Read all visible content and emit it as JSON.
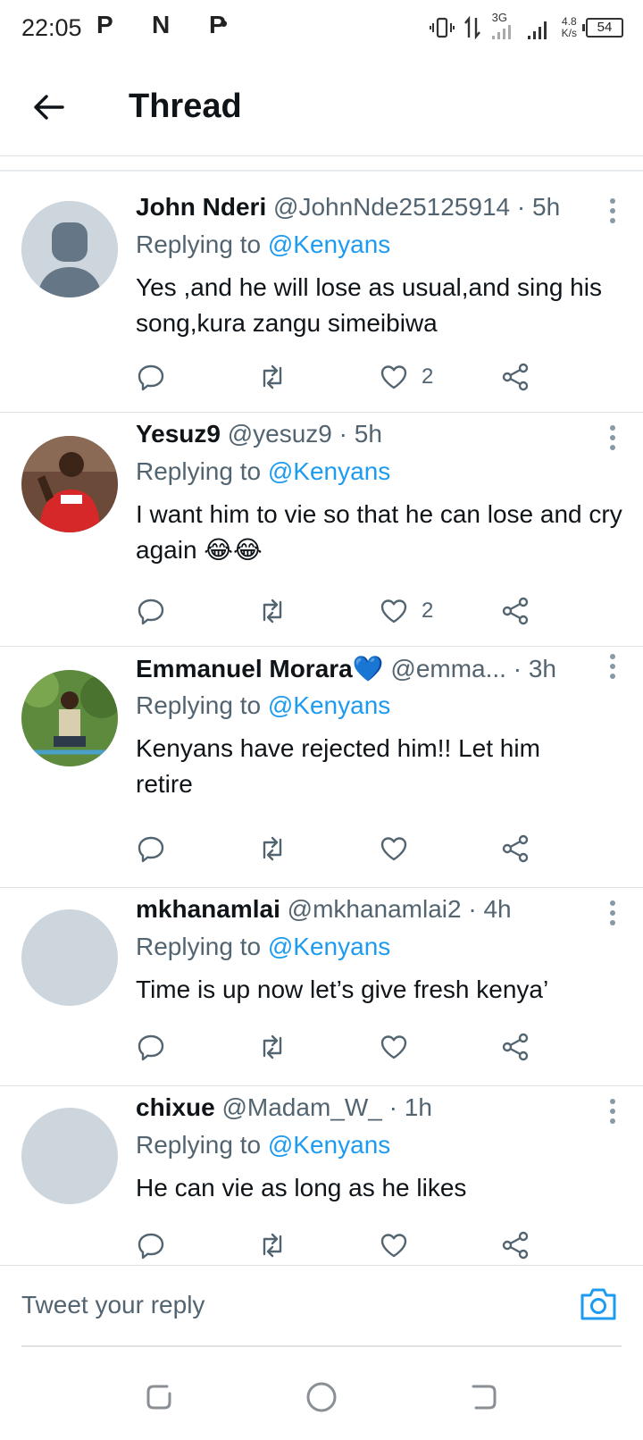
{
  "status_bar": {
    "time": "22:05",
    "app_icons": "P N P",
    "dot": "•",
    "signal": "3G",
    "speed": "4.8\nK/s",
    "battery": "54"
  },
  "header": {
    "title": "Thread"
  },
  "tweets": [
    {
      "author": "John Nderi",
      "handle": "@JohnNde25125914",
      "time": "· 5h",
      "replying_prefix": "Replying to ",
      "replying_to": "@Kenyans",
      "text": "Yes ,and he will lose as usual,and sing his song,kura zangu simeibiwa",
      "likes": "2"
    },
    {
      "author": "Yesuz9",
      "handle": "@yesuz9",
      "time": "· 5h",
      "replying_prefix": "Replying to ",
      "replying_to": "@Kenyans",
      "text": "I want him to vie so that he can lose and cry again 😂😂",
      "likes": "2"
    },
    {
      "author": "Emmanuel Morara💙",
      "handle": "@emma...",
      "time": " · 3h",
      "replying_prefix": "Replying to ",
      "replying_to": "@Kenyans",
      "text": "Kenyans have rejected him!! Let him retire",
      "likes": ""
    },
    {
      "author": "mkhanamlai",
      "handle": "@mkhanamlai2",
      "time": "· 4h",
      "replying_prefix": "Replying to ",
      "replying_to": "@Kenyans",
      "text": "Time is up now let’s give fresh kenya’",
      "likes": ""
    },
    {
      "author": "chixue",
      "handle": "@Madam_W_",
      "time": "· 1h",
      "replying_prefix": "Replying to ",
      "replying_to": "@Kenyans",
      "text": "He can vie as long as he likes",
      "likes": ""
    }
  ],
  "reply_bar": {
    "placeholder": "Tweet your reply"
  },
  "colors": {
    "accent": "#1d9bf0",
    "text": "#0f1419",
    "secondary": "#536471",
    "divider": "#dfe3e6"
  }
}
